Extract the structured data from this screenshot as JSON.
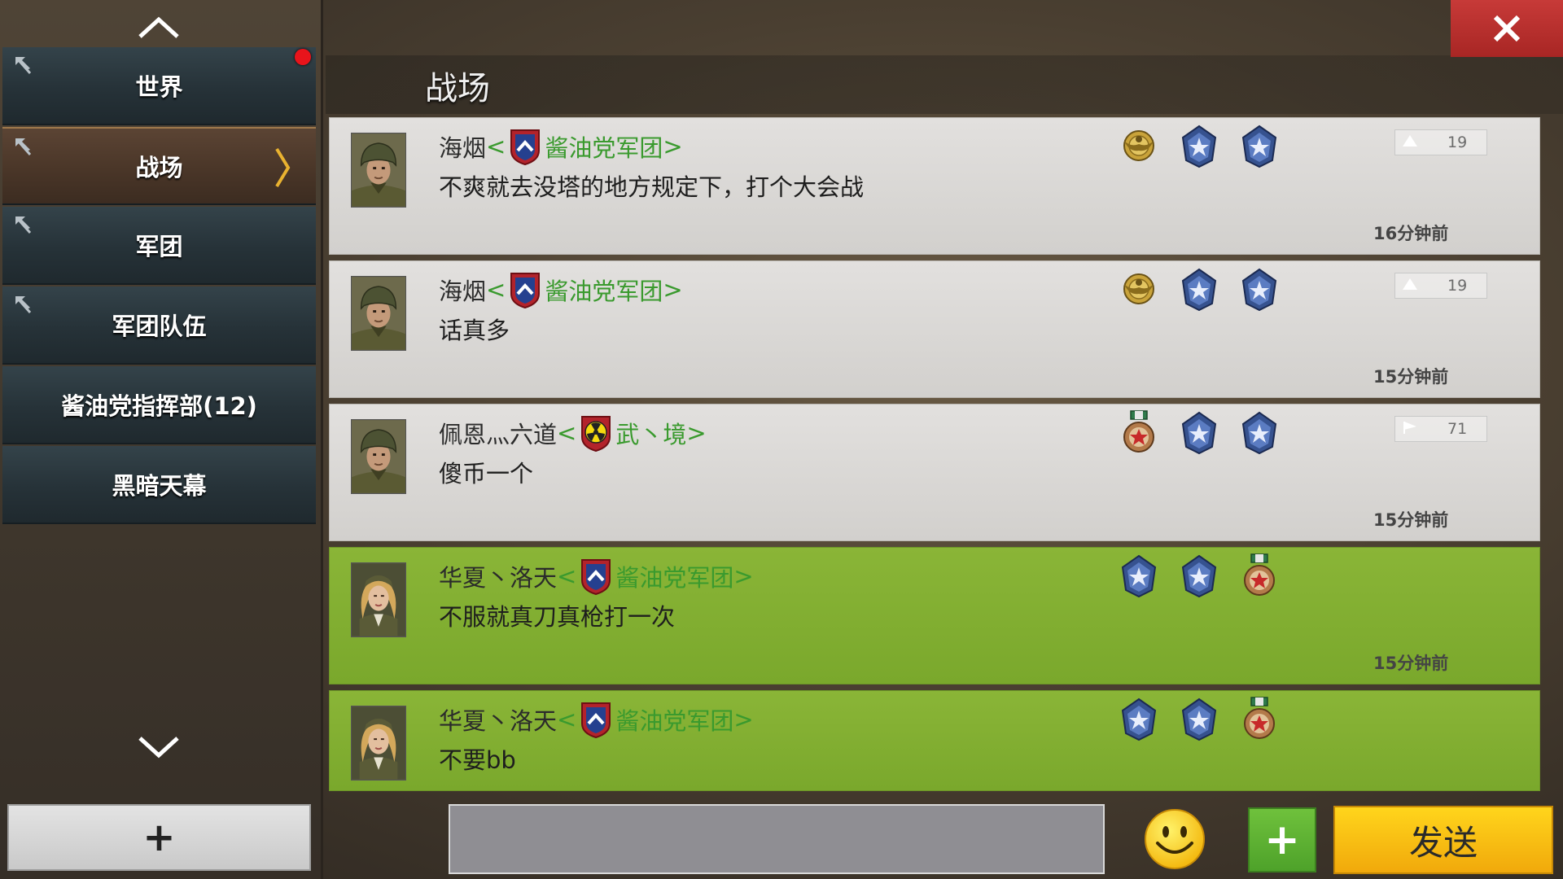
{
  "sidebar": {
    "items": [
      {
        "label": "世界",
        "pinned": true,
        "has_notification": true,
        "active": false
      },
      {
        "label": "战场",
        "pinned": true,
        "has_notification": false,
        "active": true
      },
      {
        "label": "军团",
        "pinned": true,
        "has_notification": false,
        "active": false
      },
      {
        "label": "军团队伍",
        "pinned": true,
        "has_notification": false,
        "active": false
      },
      {
        "label": "酱油党指挥部(12)",
        "pinned": false,
        "has_notification": false,
        "active": false
      },
      {
        "label": "黑暗天幕",
        "pinned": false,
        "has_notification": false,
        "active": false
      }
    ],
    "add_label": "+"
  },
  "header": {
    "title": "战场",
    "close_icon": "close-icon"
  },
  "messages": [
    {
      "sender": "海烟",
      "bracket_open": "<",
      "guild": "酱油党军团",
      "bracket_close": ">",
      "guild_icon": "chevron-shield",
      "text": "不爽就去没塔的地方规定下，打个大会战",
      "time": "16分钟前",
      "rank": "19",
      "avatar": "soldier-male",
      "ally": false,
      "medals": [
        "gold-eagle-medal",
        "blue-star-medal",
        "blue-star-medal"
      ]
    },
    {
      "sender": "海烟",
      "bracket_open": "<",
      "guild": "酱油党军团",
      "bracket_close": ">",
      "guild_icon": "chevron-shield",
      "text": "话真多",
      "time": "15分钟前",
      "rank": "19",
      "avatar": "soldier-male",
      "ally": false,
      "medals": [
        "gold-eagle-medal",
        "blue-star-medal",
        "blue-star-medal"
      ]
    },
    {
      "sender": "佩恩灬六道",
      "bracket_open": "<",
      "guild": "武丶境",
      "bracket_close": ">",
      "guild_icon": "radiation-shield",
      "text": "傻币一个",
      "time": "15分钟前",
      "rank": "71",
      "avatar": "soldier-male",
      "ally": false,
      "medals": [
        "red-star-medal",
        "blue-star-medal",
        "blue-star-medal"
      ]
    },
    {
      "sender": "华夏丶洛天",
      "bracket_open": "<",
      "guild": "酱油党军团",
      "bracket_close": ">",
      "guild_icon": "chevron-shield",
      "text": "不服就真刀真枪打一次",
      "time": "15分钟前",
      "rank": "",
      "avatar": "officer-female",
      "ally": true,
      "medals": [
        "blue-star-medal",
        "blue-star-medal",
        "red-star-medal"
      ]
    },
    {
      "sender": "华夏丶洛天",
      "bracket_open": "<",
      "guild": "酱油党军团",
      "bracket_close": ">",
      "guild_icon": "chevron-shield",
      "text": "不要bb",
      "time": "",
      "rank": "",
      "avatar": "officer-female",
      "ally": true,
      "medals": [
        "blue-star-medal",
        "blue-star-medal",
        "red-star-medal"
      ]
    }
  ],
  "composer": {
    "input_value": "",
    "input_placeholder": "",
    "emoji_icon": "smiley-icon",
    "plus_label": "+",
    "send_label": "发送"
  },
  "colors": {
    "ally_bg": "#82ae32",
    "guild_text": "#3a9a2e",
    "send_button": "#f5b813",
    "close_button": "#b52e2c"
  }
}
